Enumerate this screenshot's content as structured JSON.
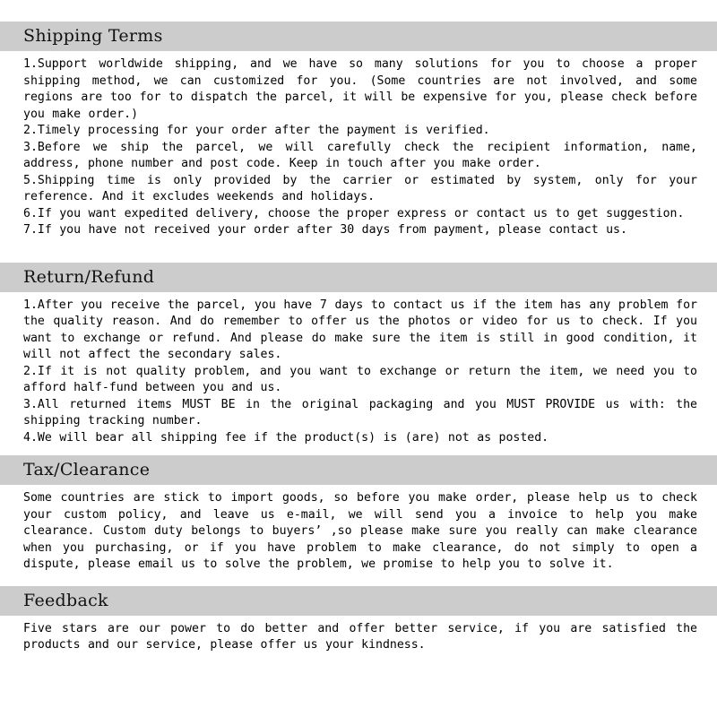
{
  "document": {
    "type": "seller-policy-page",
    "background_color": "#ffffff",
    "heading_bar_color": "#cccccc",
    "text_color": "#000000"
  },
  "sections": [
    {
      "id": "shipping-terms",
      "heading": "Shipping Terms",
      "paragraphs": [
        "1.Support worldwide shipping, and we have so many solutions for you to choose a proper shipping method, we can customized for you. (Some countries are not involved, and some regions are too for to dispatch the parcel, it will be expensive for you, please check before you make order.)",
        "2.Timely processing for your order after the payment is verified.",
        "3.Before we ship the parcel, we will carefully check the recipient information, name, address, phone number and post code. Keep in touch after you make order.",
        "5.Shipping time is only provided by the carrier or estimated by system, only for your reference. And it excludes weekends and holidays.",
        "6.If you want expedited delivery, choose the proper express or contact us to get suggestion.",
        "7.If you have not received your order after 30 days from payment, please contact us."
      ]
    },
    {
      "id": "return-refund",
      "heading": "Return/Refund",
      "paragraphs": [
        "1.After you receive the parcel, you have 7 days to contact us if the item has any problem for the quality reason. And do remember to offer us the photos or video for us to check. If you want to exchange or refund. And please do make sure the item is still in good condition, it will not affect the secondary sales.",
        "2.If it is not quality problem, and you want to exchange or return the item, we need you to afford half-fund between you and us.",
        "3.All returned items MUST BE in the original packaging and you MUST PROVIDE us with: the shipping tracking number.",
        "4.We will bear all shipping fee if the product(s) is (are) not as posted."
      ]
    },
    {
      "id": "tax-clearance",
      "heading": "Tax/Clearance",
      "paragraphs": [
        "Some countries are stick to import goods, so before you make order, please help us to check your custom policy, and leave us e-mail, we will send you a invoice to help you make clearance. Custom duty belongs to buyers’ ,so please make sure you really can make clearance when you purchasing, or if you have problem to make clearance, do not simply to open a dispute, please email us to solve the problem, we promise to help you to solve it."
      ]
    },
    {
      "id": "feedback",
      "heading": "Feedback",
      "paragraphs": [
        "Five stars are our power to do better and offer better service, if you are satisfied the products and our service, please offer us your kindness."
      ]
    }
  ]
}
